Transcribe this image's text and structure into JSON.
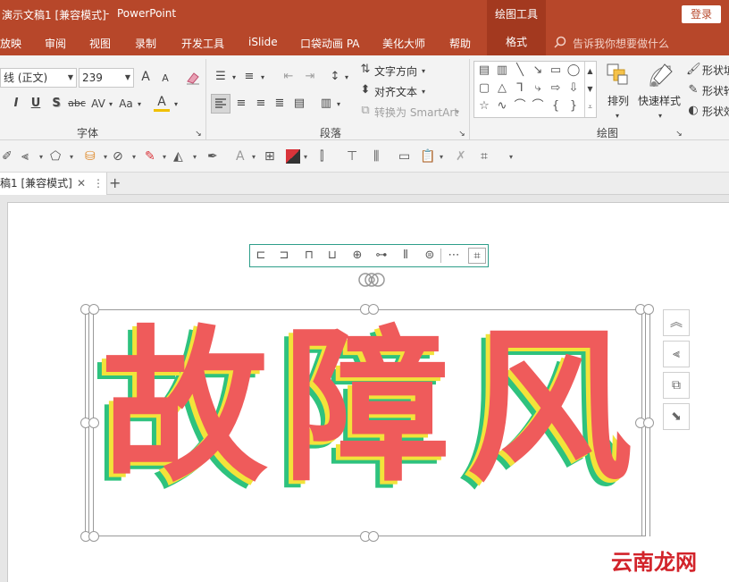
{
  "titlebar": {
    "doc_title": "演示文稿1 [兼容模式]",
    "separator": "-",
    "app_name": "PowerPoint",
    "context_tab_group": "绘图工具",
    "login_label": "登录"
  },
  "tabs": [
    "放映",
    "审阅",
    "视图",
    "录制",
    "开发工具",
    "iSlide",
    "口袋动画 PA",
    "美化大师",
    "帮助"
  ],
  "format_tab": "格式",
  "tellme": "告诉我你想要做什么",
  "font_group": {
    "font_name": "线 (正文)",
    "font_size": "239",
    "grow_icon": "A",
    "shrink_icon": "A",
    "bold": "I",
    "underline": "U",
    "shadow": "S",
    "strike": "abc",
    "spacing": "AV",
    "case": "Aa",
    "color": "A",
    "label": "字体"
  },
  "paragraph_group": {
    "text_direction": "文字方向",
    "align_text": "对齐文本",
    "smartart": "转换为 SmartArt",
    "label": "段落"
  },
  "drawing_group": {
    "arrange": "排列",
    "quick_styles": "快速样式",
    "shape_fill": "形状填",
    "shape_outline": "形状轮",
    "shape_effects": "形状效",
    "label": "绘图"
  },
  "doctab": {
    "title": "稿1 [兼容模式]",
    "close": "✕",
    "more": "⋮",
    "add": "+"
  },
  "slide_text": "故障风",
  "colors": {
    "title_bg": "#b7472a",
    "context_bg": "#a3391f",
    "glitch_red": "#ef5b5b",
    "glitch_yellow": "#f2e33a",
    "glitch_green": "#2ec27e",
    "float_border": "#2e9e8a"
  },
  "watermark": "云南龙网"
}
